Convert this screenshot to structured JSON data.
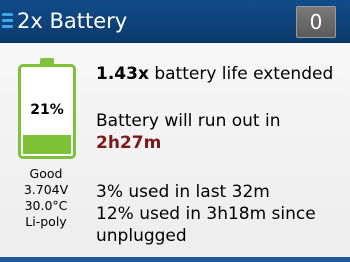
{
  "header": {
    "title": "2x Battery",
    "badge_count": "0",
    "menu_icon": "menu-icon"
  },
  "battery": {
    "percent_text": "21%",
    "level": 0.21,
    "color": "#7dc238",
    "status": "Good",
    "voltage": "3.704V",
    "temperature": "30.0°C",
    "type": "Li-poly"
  },
  "info": {
    "extended_value": "1.43x",
    "extended_text": " battery life extended",
    "runout_label": "Battery will run out in",
    "runout_time": "2h27m",
    "used_recent": "3% used in last 32m",
    "used_since_line1": "12% used in 3h18m since",
    "used_since_line2": "unplugged"
  }
}
